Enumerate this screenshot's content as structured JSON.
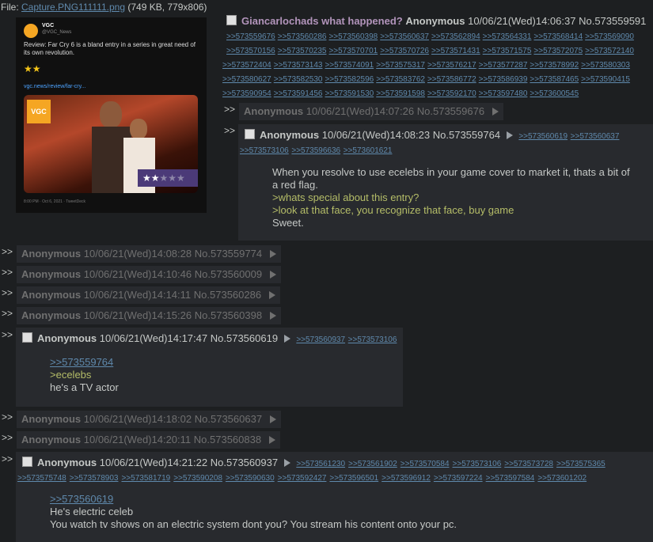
{
  "file": {
    "label": "File: ",
    "name": "Capture.PNG111111.png",
    "meta": "(749 KB, 779x806)"
  },
  "thumb_tweet": {
    "account": "VGC",
    "handle": "@VGC_News",
    "text": "Review: Far Cry 6 is a bland entry in a series in great need of its own revolution.",
    "stars": "★★",
    "url": "vgc.news/review/far-cry...",
    "badge": "VGC",
    "time": "8:00 PM · Oct 6, 2021 · TweetDeck"
  },
  "op": {
    "subject": "Giancarlochads what happened?",
    "name": "Anonymous",
    "datetime": "10/06/21(Wed)14:06:37",
    "number": "No.573559591",
    "backlink_rows": [
      [
        ">>573559676",
        ">>573560286",
        ">>573560398",
        ">>573560637",
        ">>573562894",
        ">>573564331",
        ">>573568414",
        ">>573569090"
      ],
      [
        ">>573570156",
        ">>573570235",
        ">>573570701",
        ">>573570726",
        ">>573571431",
        ">>573571575",
        ">>573572075",
        ">>573572140"
      ],
      [
        ">>573572404",
        ">>573573143",
        ">>573574091",
        ">>573575317",
        ">>573576217",
        ">>573577287",
        ">>573578992",
        ">>573580303"
      ],
      [
        ">>573580627",
        ">>573582530",
        ">>573582596",
        ">>573583762",
        ">>573586772",
        ">>573586939",
        ">>573587465",
        ">>573590415"
      ],
      [
        ">>573590954",
        ">>573591456",
        ">>573591530",
        ">>573591598",
        ">>573592170",
        ">>573597480",
        ">>573600545"
      ]
    ]
  },
  "arrows": ">>",
  "posts": {
    "p1": {
      "name": "Anonymous",
      "datetime": "10/06/21(Wed)14:07:26",
      "number": "No.573559676"
    },
    "p2": {
      "name": "Anonymous",
      "datetime": "10/06/21(Wed)14:08:23",
      "number": "No.573559764",
      "backlinks_line1": [
        ">>573560619",
        ">>573560637"
      ],
      "backlinks_line2": [
        ">>573573106",
        ">>573596636",
        ">>573601621"
      ],
      "lines": [
        {
          "text": "When you resolve to use ecelebs in your game cover to market it, thats a bit of",
          "quote": false
        },
        {
          "text": "a red flag.",
          "quote": false
        },
        {
          "text": ">whats special about this entry?",
          "quote": true
        },
        {
          "text": ">look at that face, you recognize that face, buy game",
          "quote": true
        },
        {
          "text": "Sweet.",
          "quote": false
        }
      ]
    },
    "p3": {
      "name": "Anonymous",
      "datetime": "10/06/21(Wed)14:08:28",
      "number": "No.573559774"
    },
    "p4": {
      "name": "Anonymous",
      "datetime": "10/06/21(Wed)14:10:46",
      "number": "No.573560009"
    },
    "p5": {
      "name": "Anonymous",
      "datetime": "10/06/21(Wed)14:14:11",
      "number": "No.573560286"
    },
    "p6": {
      "name": "Anonymous",
      "datetime": "10/06/21(Wed)14:15:26",
      "number": "No.573560398"
    },
    "p7": {
      "name": "Anonymous",
      "datetime": "10/06/21(Wed)14:17:47",
      "number": "No.573560619",
      "backlinks": [
        ">>573560937",
        ">>573573106"
      ],
      "quotelink": ">>573559764",
      "greentext": ">ecelebs",
      "text": "he's a TV actor"
    },
    "p8": {
      "name": "Anonymous",
      "datetime": "10/06/21(Wed)14:18:02",
      "number": "No.573560637"
    },
    "p9": {
      "name": "Anonymous",
      "datetime": "10/06/21(Wed)14:20:11",
      "number": "No.573560838"
    },
    "p10": {
      "name": "Anonymous",
      "datetime": "10/06/21(Wed)14:21:22",
      "number": "No.573560937",
      "backlinks_line1": [
        ">>573561230",
        ">>573561902",
        ">>573570584",
        ">>573573106",
        ">>573573728",
        ">>573575365"
      ],
      "backlinks_line2": [
        ">>573575748",
        ">>573578903",
        ">>573581719",
        ">>573590208",
        ">>573590630",
        ">>573592427",
        ">>573596501",
        ">>573596912",
        ">>573597224",
        ">>573597584",
        ">>573601202"
      ],
      "quotelink": ">>573560619",
      "line1": "He's electric celeb",
      "line2": "You watch tv shows on an electric system dont you? You stream his content onto your pc."
    }
  }
}
